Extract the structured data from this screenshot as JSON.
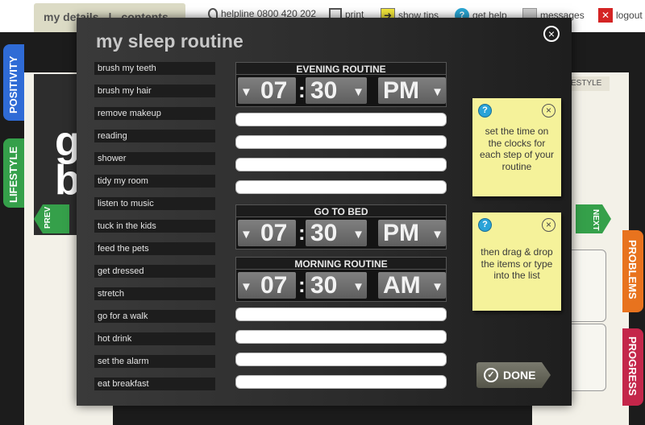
{
  "topbar": {
    "tab_details": "my details",
    "tab_sep": "|",
    "tab_contents": "contents",
    "helpline": "helpline 0800 420 202",
    "print": "print",
    "show_tips": "show tips",
    "get_help": "get help",
    "messages": "messages",
    "logout": "logout"
  },
  "book": {
    "side_tabs": {
      "positivity": "POSITIVITY",
      "lifestyle": "LIFESTYLE",
      "problems": "PROBLEMS",
      "progress": "PROGRESS"
    },
    "prev": "PREV",
    "next": "NEXT",
    "lifestyle_header": "ESTYLE",
    "strip_text": "g\nb"
  },
  "colors": {
    "positivity": "#2f6bd6",
    "lifestyle": "#35a04a",
    "problems": "#e8731e",
    "progress": "#c4264a"
  },
  "modal": {
    "title": "my sleep routine",
    "close_icon": "×",
    "items": [
      "brush my teeth",
      "brush my hair",
      "remove makeup",
      "reading",
      "shower",
      "tidy my room",
      "listen to music",
      "tuck in the kids",
      "feed the pets",
      "get dressed",
      "stretch",
      "go for a walk",
      "hot drink",
      "set the alarm",
      "eat breakfast"
    ],
    "clocks": {
      "evening": {
        "label": "EVENING ROUTINE",
        "hour": "07",
        "minute": "30",
        "ampm": "PM"
      },
      "bed": {
        "label": "GO TO BED",
        "hour": "07",
        "minute": "30",
        "ampm": "PM"
      },
      "morning": {
        "label": "MORNING ROUTINE",
        "hour": "07",
        "minute": "30",
        "ampm": "AM"
      }
    },
    "colon": ":",
    "down_arrow": "▼",
    "notes": [
      {
        "text": "set the time on the clocks for each step of your routine",
        "q": "?",
        "x": "×"
      },
      {
        "text": "then drag & drop the items or type into the list",
        "q": "?",
        "x": "×"
      }
    ],
    "done": "DONE",
    "done_check": "✓"
  }
}
